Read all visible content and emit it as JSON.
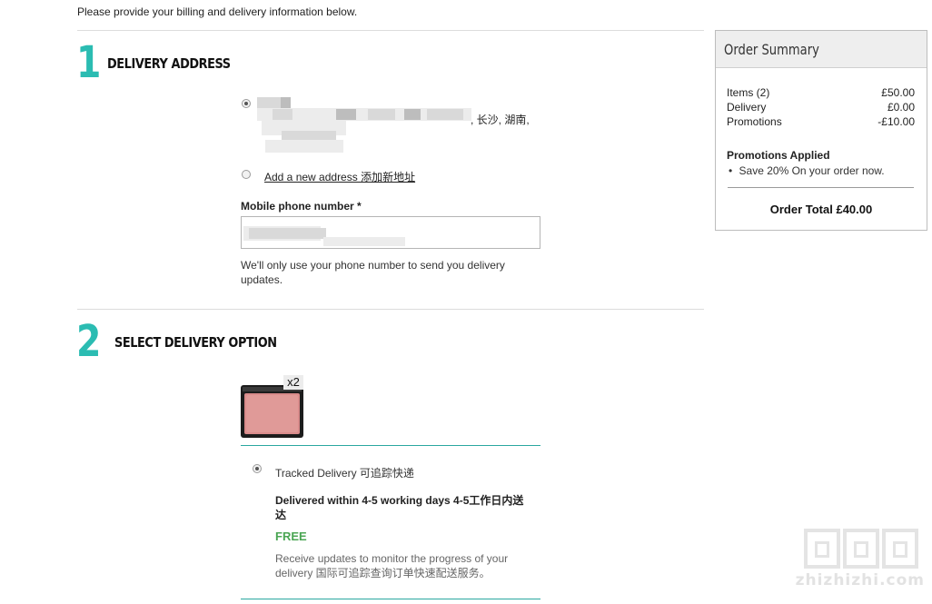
{
  "intro_text": "Please provide your billing and delivery information below.",
  "delivery_address": {
    "step_number": "1",
    "title": "DELIVERY ADDRESS",
    "saved_address_tail": ", 长沙, 湖南,",
    "add_new_label": "Add a new address 添加新地址",
    "phone_label": "Mobile phone number *",
    "phone_help": "We'll only use your phone number to send you delivery updates."
  },
  "delivery_option": {
    "step_number": "2",
    "title": "SELECT DELIVERY OPTION",
    "quantity": "x2",
    "option_label": "Tracked Delivery 可追踪快递",
    "option_time": "Delivered within 4-5 working days 4-5工作日内送达",
    "option_price": "FREE",
    "option_desc": "Receive updates to monitor the progress of your delivery 国际可追踪查询订单快速配送服务。"
  },
  "order_summary": {
    "title": "Order Summary",
    "rows": [
      {
        "label": "Items (2)",
        "value": "£50.00"
      },
      {
        "label": "Delivery",
        "value": "£0.00"
      },
      {
        "label": "Promotions",
        "value": "-£10.00"
      }
    ],
    "promotions_heading": "Promotions Applied",
    "promotion_item": "Save 20% On your order now.",
    "total": "Order Total £40.00"
  },
  "watermark_text": "zhizhizhi.com",
  "colors": {
    "accent": "#2bbcb2",
    "free_green": "#4aa553"
  }
}
